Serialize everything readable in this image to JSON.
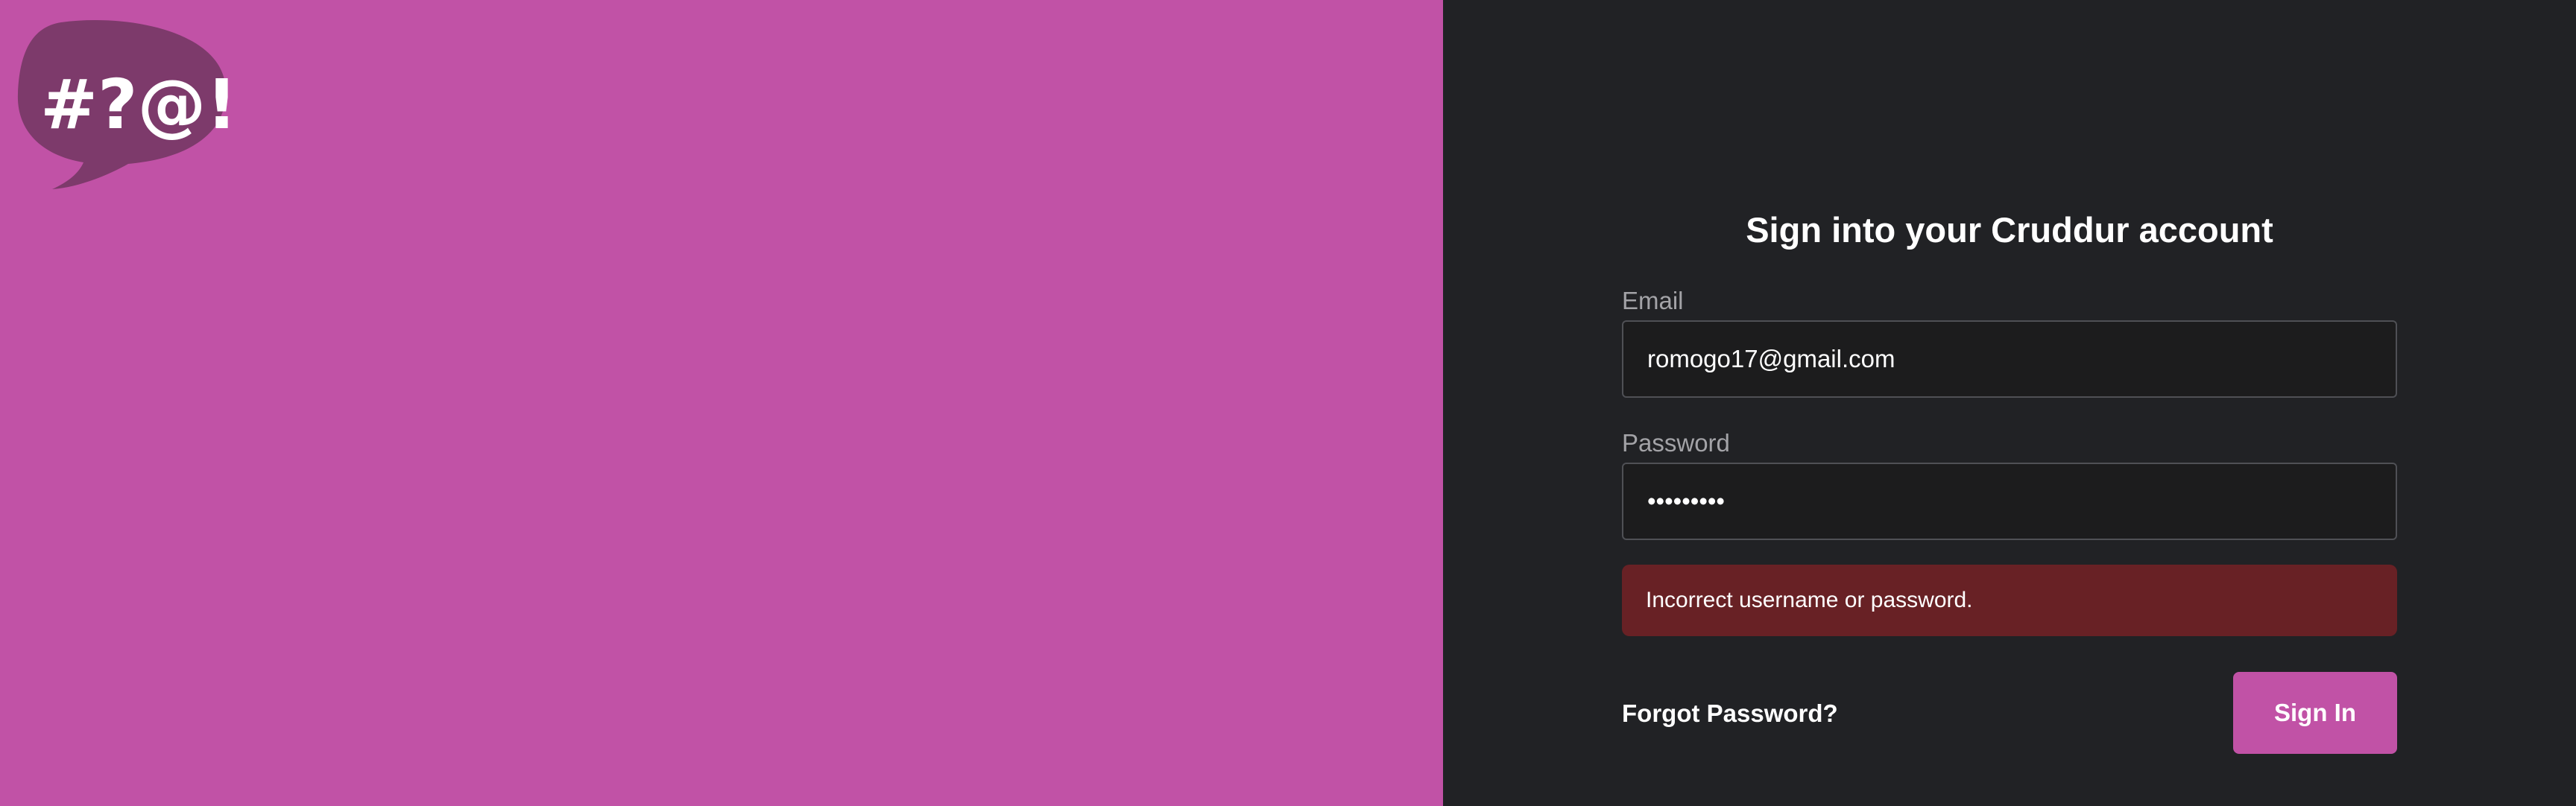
{
  "colors": {
    "brand": "#c152a6",
    "panel_background": "#212225",
    "error_background": "#682125",
    "logo_bubble": "#7d3a6b"
  },
  "logo": {
    "icon": "speech-bubble-logo-icon",
    "text": "#?@!"
  },
  "login": {
    "title": "Sign into your Cruddur account",
    "email": {
      "label": "Email",
      "value": "romogo17@gmail.com"
    },
    "password": {
      "label": "Password",
      "value": "•••••••••"
    },
    "error_message": "Incorrect username or password.",
    "forgot_password_label": "Forgot Password?",
    "sign_in_label": "Sign In"
  }
}
